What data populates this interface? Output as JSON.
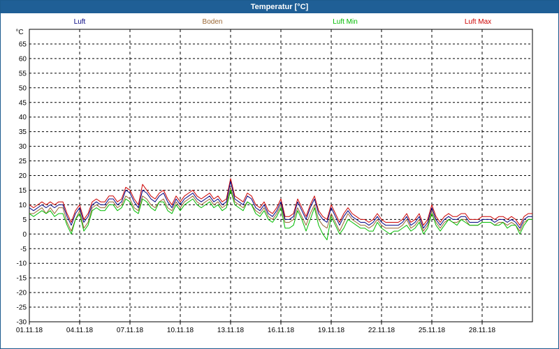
{
  "window": {
    "title": "Temperatur [°C]"
  },
  "chart_data": {
    "type": "line",
    "title": "Temperatur [°C]",
    "ylabel": "°C",
    "ylim": [
      -30,
      70
    ],
    "yticks": [
      65,
      60,
      55,
      50,
      45,
      40,
      35,
      30,
      25,
      20,
      15,
      10,
      5,
      0,
      -5,
      -10,
      -15,
      -20,
      -25,
      -30
    ],
    "xlim": [
      1,
      31
    ],
    "xticks": [
      {
        "x": 1,
        "label": "01.11.18"
      },
      {
        "x": 4,
        "label": "04.11.18"
      },
      {
        "x": 7,
        "label": "07.11.18"
      },
      {
        "x": 10,
        "label": "10.11.18"
      },
      {
        "x": 13,
        "label": "13.11.18"
      },
      {
        "x": 16,
        "label": "16.11.18"
      },
      {
        "x": 19,
        "label": "19.11.18"
      },
      {
        "x": 22,
        "label": "22.11.18"
      },
      {
        "x": 25,
        "label": "25.11.18"
      },
      {
        "x": 28,
        "label": "28.11.18"
      }
    ],
    "grid": true,
    "legend_position": "top",
    "colors": {
      "luft": "#000080",
      "boden": "#996633",
      "min": "#00bb00",
      "max": "#cc0000"
    },
    "x": [
      1.0,
      1.25,
      1.5,
      1.75,
      2.0,
      2.25,
      2.5,
      2.75,
      3.0,
      3.25,
      3.5,
      3.75,
      4.0,
      4.25,
      4.5,
      4.75,
      5.0,
      5.25,
      5.5,
      5.75,
      6.0,
      6.25,
      6.5,
      6.75,
      7.0,
      7.25,
      7.5,
      7.75,
      8.0,
      8.25,
      8.5,
      8.75,
      9.0,
      9.25,
      9.5,
      9.75,
      10.0,
      10.25,
      10.5,
      10.75,
      11.0,
      11.25,
      11.5,
      11.75,
      12.0,
      12.25,
      12.5,
      12.75,
      13.0,
      13.25,
      13.5,
      13.75,
      14.0,
      14.25,
      14.5,
      14.75,
      15.0,
      15.25,
      15.5,
      15.75,
      16.0,
      16.25,
      16.5,
      16.75,
      17.0,
      17.25,
      17.5,
      17.75,
      18.0,
      18.25,
      18.5,
      18.75,
      19.0,
      19.25,
      19.5,
      19.75,
      20.0,
      20.25,
      20.5,
      20.75,
      21.0,
      21.25,
      21.5,
      21.75,
      22.0,
      22.25,
      22.5,
      22.75,
      23.0,
      23.25,
      23.5,
      23.75,
      24.0,
      24.25,
      24.5,
      24.75,
      25.0,
      25.25,
      25.5,
      25.75,
      26.0,
      26.25,
      26.5,
      26.75,
      27.0,
      27.25,
      27.5,
      27.75,
      28.0,
      28.25,
      28.5,
      28.75,
      29.0,
      29.25,
      29.5,
      29.75,
      30.0,
      30.25,
      30.5,
      30.75,
      31.0
    ],
    "series": [
      {
        "name": "Luft",
        "values": [
          9,
          8,
          9,
          10,
          9,
          10,
          9,
          10,
          10,
          6,
          3,
          7,
          9,
          4,
          6,
          10,
          11,
          10,
          10,
          12,
          12,
          10,
          11,
          15,
          14,
          11,
          9,
          15,
          14,
          12,
          11,
          13,
          14,
          11,
          9,
          12,
          10,
          12,
          13,
          14,
          12,
          11,
          12,
          13,
          11,
          12,
          10,
          11,
          18,
          12,
          11,
          10,
          13,
          12,
          9,
          8,
          10,
          7,
          6,
          8,
          11,
          5,
          5,
          6,
          11,
          8,
          5,
          9,
          12,
          7,
          5,
          4,
          9,
          6,
          3,
          6,
          8,
          6,
          5,
          4,
          4,
          3,
          4,
          6,
          4,
          3,
          3,
          3,
          3,
          4,
          6,
          3,
          4,
          6,
          2,
          4,
          9,
          5,
          3,
          5,
          6,
          5,
          5,
          6,
          6,
          4,
          4,
          4,
          5,
          5,
          5,
          4,
          5,
          5,
          4,
          5,
          4,
          2,
          5,
          6,
          6,
          6,
          7,
          8,
          9,
          11,
          7
        ]
      },
      {
        "name": "Boden",
        "values": [
          7,
          7,
          8,
          9,
          7,
          9,
          7,
          9,
          9,
          4,
          1,
          5,
          8,
          2,
          4,
          9,
          10,
          9,
          9,
          11,
          11,
          9,
          10,
          13,
          12,
          9,
          8,
          13,
          12,
          10,
          9,
          11,
          12,
          9,
          8,
          11,
          9,
          11,
          12,
          13,
          11,
          10,
          11,
          12,
          10,
          11,
          9,
          10,
          16,
          11,
          10,
          9,
          11,
          10,
          8,
          7,
          9,
          6,
          5,
          7,
          10,
          4,
          4,
          5,
          9,
          6,
          3,
          7,
          10,
          5,
          3,
          2,
          7,
          4,
          1,
          4,
          7,
          5,
          4,
          3,
          3,
          2,
          3,
          5,
          3,
          2,
          2,
          2,
          2,
          3,
          5,
          2,
          3,
          5,
          1,
          3,
          8,
          4,
          2,
          4,
          5,
          4,
          4,
          5,
          5,
          3,
          3,
          3,
          4,
          4,
          4,
          3,
          4,
          4,
          3,
          4,
          3,
          1,
          4,
          5,
          5,
          5,
          6,
          7,
          8,
          10,
          6
        ]
      },
      {
        "name": "Luft Min",
        "values": [
          7,
          6,
          7,
          8,
          7,
          8,
          6,
          7,
          7,
          3,
          0,
          5,
          7,
          1,
          3,
          8,
          9,
          8,
          8,
          10,
          10,
          8,
          9,
          12,
          11,
          8,
          7,
          12,
          11,
          9,
          8,
          11,
          11,
          8,
          7,
          10,
          8,
          10,
          11,
          12,
          10,
          9,
          10,
          11,
          9,
          10,
          8,
          9,
          15,
          10,
          9,
          8,
          11,
          10,
          7,
          6,
          8,
          5,
          4,
          6,
          9,
          2,
          2,
          3,
          8,
          5,
          1,
          5,
          9,
          3,
          0,
          -2,
          6,
          3,
          0,
          2,
          5,
          4,
          3,
          2,
          2,
          1,
          1,
          4,
          2,
          1,
          0,
          1,
          1,
          2,
          3,
          1,
          2,
          4,
          0,
          2,
          7,
          3,
          1,
          3,
          5,
          4,
          3,
          5,
          4,
          3,
          3,
          3,
          4,
          4,
          4,
          3,
          3,
          4,
          2,
          3,
          3,
          0,
          3,
          5,
          5,
          5,
          6,
          7,
          8,
          9,
          5
        ]
      },
      {
        "name": "Luft Max",
        "values": [
          10,
          9,
          10,
          11,
          10,
          11,
          10,
          11,
          11,
          7,
          4,
          8,
          10,
          5,
          7,
          11,
          12,
          11,
          11,
          13,
          13,
          11,
          12,
          16,
          15,
          12,
          10,
          17,
          15,
          13,
          12,
          14,
          15,
          12,
          10,
          13,
          11,
          13,
          14,
          15,
          13,
          12,
          13,
          14,
          12,
          13,
          11,
          12,
          19,
          13,
          12,
          11,
          14,
          13,
          10,
          9,
          11,
          8,
          7,
          9,
          12,
          6,
          6,
          7,
          12,
          9,
          6,
          10,
          13,
          8,
          6,
          5,
          10,
          7,
          4,
          7,
          9,
          7,
          6,
          5,
          5,
          4,
          5,
          7,
          5,
          4,
          4,
          4,
          4,
          5,
          7,
          4,
          5,
          7,
          3,
          5,
          10,
          6,
          4,
          6,
          7,
          6,
          6,
          7,
          7,
          5,
          5,
          5,
          6,
          6,
          6,
          5,
          6,
          6,
          5,
          6,
          5,
          3,
          6,
          7,
          7,
          7,
          8,
          9,
          10,
          12,
          8
        ]
      }
    ]
  }
}
